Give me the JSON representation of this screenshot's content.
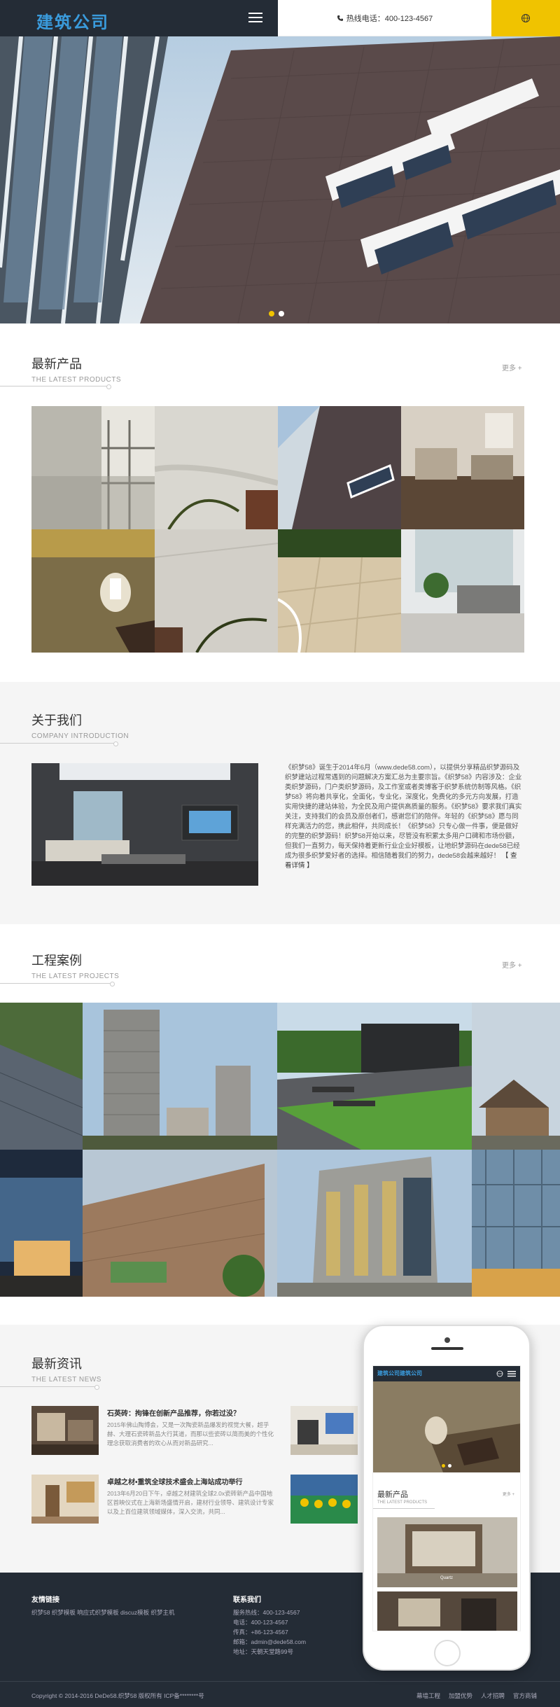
{
  "header": {
    "logo_text": "建筑公司",
    "phone_text": "热线电话：400-123-4567",
    "icons": {
      "menu": "menu-icon",
      "phone": "phone-icon",
      "language": "globe-icon"
    },
    "colors": {
      "dark": "#242c36",
      "accent": "#f0c300",
      "logo": "#3a9bdc"
    }
  },
  "banner": {
    "slides": 2,
    "active_slide": 1
  },
  "products": {
    "title": "最新产品",
    "subtitle": "THE LATEST PRODUCTS",
    "more": "更多 +"
  },
  "about": {
    "title": "关于我们",
    "subtitle": "COMPANY INTRODUCTION",
    "text": "《织梦58》诞生于2014年6月（www.dede58.com），以提供分享精品织梦源码及织梦建站过程常遇到的问题解决方案汇总为主要宗旨。《织梦58》内容涉及：企业类织梦源码，门户类织梦源码，及工作室或者类博客于织梦系统仿制等风格。《织梦58》将向着共享化，全面化，专业化，深度化，免费化的多元方向发展，打造实用快捷的建站体验，为全民及用户提供高质量的服务。《织梦58》要求我们真实关注，支持我们的会员及原创者们，感谢您们的陪伴。年轻的《织梦58》愿与同样充满活力的您，携此相伴，共同成长！《织梦58》只专心做一件事，便是做好的完整的织梦源码！织梦58开始以来，尽管没有积累太多用户口碑和市场份额，但我们一直努力，每天保持着更新行业企业好模板，让地织梦源码在dede58已经成为很多织梦爱好者的选择。相信随着我们的努力，dede58会越来越好！",
    "more": "【 查看详情 】"
  },
  "cases": {
    "title": "工程案例",
    "subtitle": "THE LATEST PROJECTS",
    "more": "更多 +"
  },
  "news": {
    "title": "最新资讯",
    "subtitle": "THE LATEST NEWS",
    "items": [
      {
        "title": "石英砖：拘锋在创新产品推荐，你若过没？",
        "desc": "2015年佛山陶博会，又是一次陶瓷新品爆发的视觉大餐，超乎赫、大理石瓷砖新品大行其道，而那以些瓷砖以简而美的个性化理念获取消费者的欢心从而对新品研究..."
      },
      {
        "title": "卓越之材•重筑全球技术盛会上海站成功举行",
        "desc": "2013年6月20日下午，卓越之材建筑全球2.0x瓷砖新产品中国地区首映仪式在上海新场盛情开启，建材行业领导、建筑设计专家以及上百位建筑领域媒体，深入交流，共同..."
      }
    ]
  },
  "footer": {
    "links_title": "友情链接",
    "links_text": "织梦58 织梦模板 响应式织梦模板 discuz模板 织梦主机",
    "contact_title": "联系我们",
    "contact_lines": [
      "服务热线：400-123-4567",
      "电话：400-123-4567",
      "传真：+86-123-4567",
      "邮箱：admin@dede58.com",
      "地址：天朝天堂路99号"
    ],
    "copyright": "Copyright © 2014-2016 DeDe58.织梦58 版权所有    ICP备********号",
    "bottom_links": [
      "幕墙工程",
      "加盟优势",
      "人才招聘",
      "官方商铺"
    ]
  },
  "phone_preview": {
    "logo": "建筑公司建筑公司",
    "section_title": "最新产品",
    "section_sub": "THE LATEST PRODUCTS",
    "more": "更多 +",
    "caption": "Quartz"
  }
}
